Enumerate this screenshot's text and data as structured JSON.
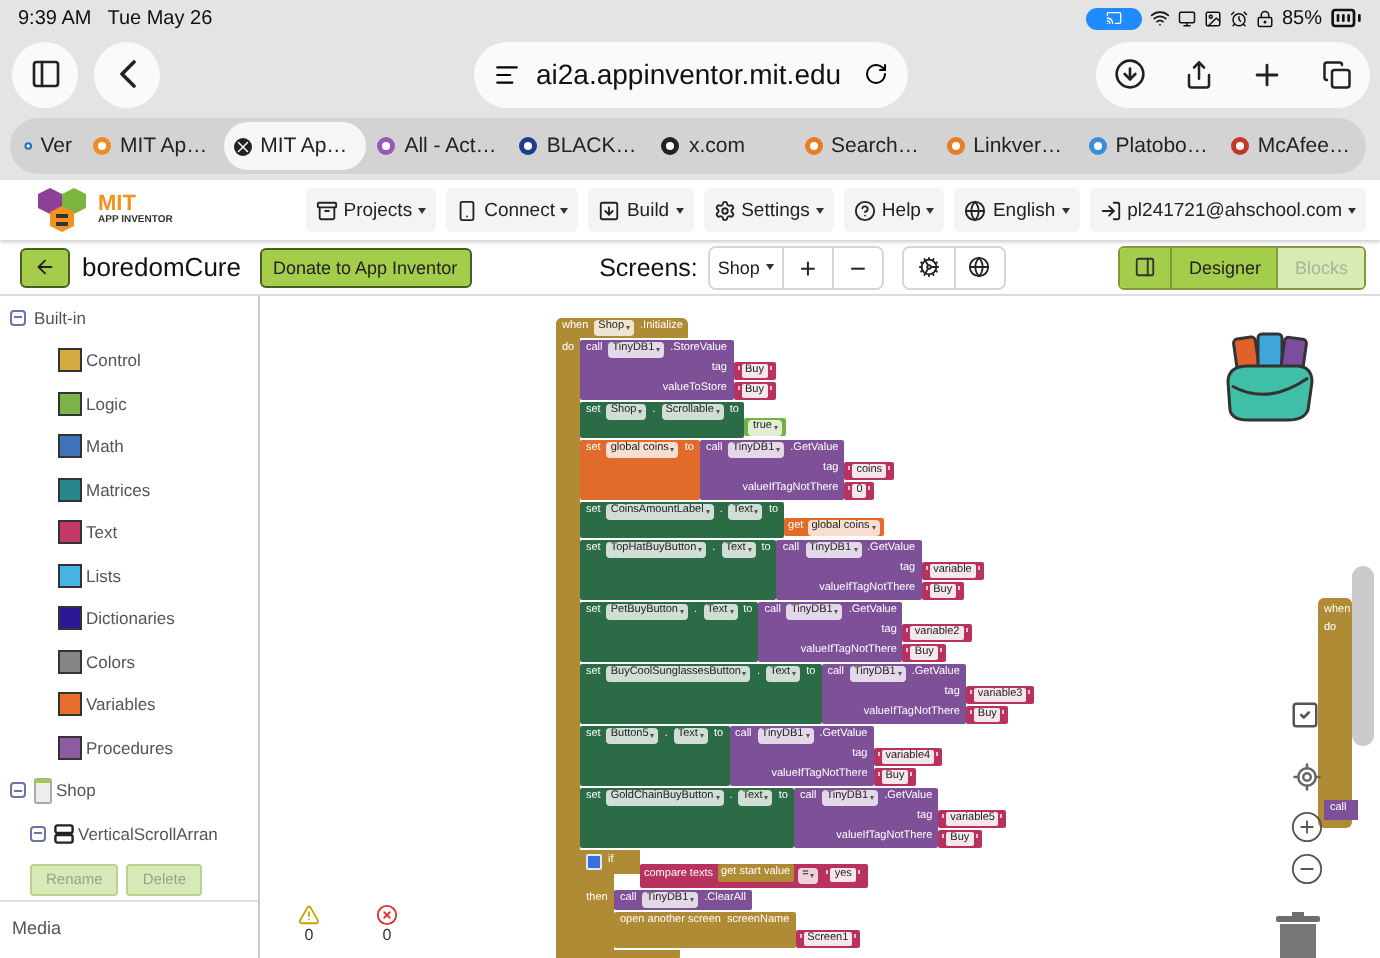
{
  "status_bar": {
    "time": "9:39 AM",
    "date": "Tue May 26",
    "battery": "85%"
  },
  "browser": {
    "url": "ai2a.appinventor.mit.edu",
    "tabs": [
      {
        "label": "Ver",
        "selected": false
      },
      {
        "label": "MIT Ap…",
        "selected": false
      },
      {
        "label": "MIT Ap…",
        "selected": true
      },
      {
        "label": "All - Act…",
        "selected": false
      },
      {
        "label": "BLACK…",
        "selected": false
      },
      {
        "label": "x.com",
        "selected": false
      },
      {
        "label": "Search…",
        "selected": false
      },
      {
        "label": "Linkver…",
        "selected": false
      },
      {
        "label": "Platobo…",
        "selected": false
      },
      {
        "label": "McAfee…",
        "selected": false
      }
    ]
  },
  "app_header": {
    "logo": {
      "title": "MIT",
      "subtitle": "APP INVENTOR"
    },
    "menu": [
      {
        "label": "Projects"
      },
      {
        "label": "Connect"
      },
      {
        "label": "Build"
      },
      {
        "label": "Settings"
      },
      {
        "label": "Help"
      },
      {
        "label": "English"
      },
      {
        "label": "pl241721@ahschool.com"
      }
    ]
  },
  "toolbar": {
    "project_name": "boredomCure",
    "donate": "Donate to App Inventor",
    "screens_label": "Screens:",
    "screen": "Shop",
    "add": "+",
    "remove": "−",
    "views": [
      {
        "label": "Designer",
        "disabled": false
      },
      {
        "label": "Blocks",
        "disabled": true
      }
    ]
  },
  "sidebar": {
    "tree": [
      {
        "kind": "group",
        "label": "Built-in",
        "expanded": true,
        "children": [
          {
            "kind": "category",
            "label": "Control",
            "color": "#d4a93f"
          },
          {
            "kind": "category",
            "label": "Logic",
            "color": "#7cb447"
          },
          {
            "kind": "category",
            "label": "Math",
            "color": "#3f72b8"
          },
          {
            "kind": "category",
            "label": "Matrices",
            "color": "#25878d"
          },
          {
            "kind": "category",
            "label": "Text",
            "color": "#c7386a"
          },
          {
            "kind": "category",
            "label": "Lists",
            "color": "#46b3e6"
          },
          {
            "kind": "category",
            "label": "Dictionaries",
            "color": "#2c1596"
          },
          {
            "kind": "category",
            "label": "Colors",
            "color": "#858585"
          },
          {
            "kind": "category",
            "label": "Variables",
            "color": "#e6702e"
          },
          {
            "kind": "category",
            "label": "Procedures",
            "color": "#8b5ca2"
          }
        ]
      },
      {
        "kind": "screen",
        "label": "Shop",
        "expanded": true,
        "children": [
          {
            "kind": "arrangement",
            "label": "VerticalScrollArran",
            "expanded": true
          }
        ]
      }
    ],
    "buttons": [
      {
        "label": "Rename",
        "disabled": true
      },
      {
        "label": "Delete",
        "disabled": true
      }
    ],
    "media": "Media"
  },
  "workspace": {
    "event": {
      "label": "when",
      "component": "Shop",
      "event": ".Initialize",
      "do_label": "do",
      "statements": [
        {
          "kind": "call",
          "label": "call",
          "component": "TinyDB1",
          "method": ".StoreValue",
          "args": [
            {
              "name": "tag",
              "value": {
                "kind": "text",
                "text": "Buy"
              }
            },
            {
              "name": "valueToStore",
              "value": {
                "kind": "text",
                "text": "Buy"
              }
            }
          ]
        },
        {
          "kind": "set_property",
          "label": "set",
          "component": "Shop",
          "dot": ".",
          "property": "Scrollable",
          "to": "to",
          "value": {
            "kind": "bool",
            "text": "true"
          }
        },
        {
          "kind": "set_global",
          "label": "set",
          "name": "global coins",
          "to": "to",
          "value": {
            "kind": "call",
            "label": "call",
            "component": "TinyDB1",
            "method": ".GetValue",
            "args": [
              {
                "name": "tag",
                "value": {
                  "kind": "text",
                  "text": "coins"
                }
              },
              {
                "name": "valueIfTagNotThere",
                "value": {
                  "kind": "text",
                  "text": "0"
                }
              }
            ]
          }
        },
        {
          "kind": "set_property",
          "label": "set",
          "component": "CoinsAmountLabel",
          "dot": ".",
          "property": "Text",
          "to": "to",
          "value": {
            "kind": "get",
            "label": "get",
            "name": "global coins"
          }
        },
        {
          "kind": "set_property",
          "label": "set",
          "component": "TopHatBuyButton",
          "dot": ".",
          "property": "Text",
          "to": "to",
          "value": {
            "kind": "call",
            "label": "call",
            "component": "TinyDB1",
            "method": ".GetValue",
            "args": [
              {
                "name": "tag",
                "value": {
                  "kind": "text",
                  "text": "variable"
                }
              },
              {
                "name": "valueIfTagNotThere",
                "value": {
                  "kind": "text",
                  "text": "Buy"
                }
              }
            ]
          }
        },
        {
          "kind": "set_property",
          "label": "set",
          "component": "PetBuyButton",
          "dot": ".",
          "property": "Text",
          "to": "to",
          "value": {
            "kind": "call",
            "label": "call",
            "component": "TinyDB1",
            "method": ".GetValue",
            "args": [
              {
                "name": "tag",
                "value": {
                  "kind": "text",
                  "text": "variable2"
                }
              },
              {
                "name": "valueIfTagNotThere",
                "value": {
                  "kind": "text",
                  "text": "Buy"
                }
              }
            ]
          }
        },
        {
          "kind": "set_property",
          "label": "set",
          "component": "BuyCoolSunglassesButton",
          "dot": ".",
          "property": "Text",
          "to": "to",
          "value": {
            "kind": "call",
            "label": "call",
            "component": "TinyDB1",
            "method": ".GetValue",
            "args": [
              {
                "name": "tag",
                "value": {
                  "kind": "text",
                  "text": "variable3"
                }
              },
              {
                "name": "valueIfTagNotThere",
                "value": {
                  "kind": "text",
                  "text": "Buy"
                }
              }
            ]
          }
        },
        {
          "kind": "set_property",
          "label": "set",
          "component": "Button5",
          "dot": ".",
          "property": "Text",
          "to": "to",
          "value": {
            "kind": "call",
            "label": "call",
            "component": "TinyDB1",
            "method": ".GetValue",
            "args": [
              {
                "name": "tag",
                "value": {
                  "kind": "text",
                  "text": "variable4"
                }
              },
              {
                "name": "valueIfTagNotThere",
                "value": {
                  "kind": "text",
                  "text": "Buy"
                }
              }
            ]
          }
        },
        {
          "kind": "set_property",
          "label": "set",
          "component": "GoldChainBuyButton",
          "dot": ".",
          "property": "Text",
          "to": "to",
          "value": {
            "kind": "call",
            "label": "call",
            "component": "TinyDB1",
            "method": ".GetValue",
            "args": [
              {
                "name": "tag",
                "value": {
                  "kind": "text",
                  "text": "variable5"
                }
              },
              {
                "name": "valueIfTagNotThere",
                "value": {
                  "kind": "text",
                  "text": "Buy"
                }
              }
            ]
          }
        },
        {
          "kind": "if",
          "label": "if",
          "condition": {
            "kind": "compare",
            "label": "compare texts",
            "left": {
              "kind": "control",
              "label": "get start value"
            },
            "operator": "=",
            "right": {
              "kind": "text",
              "text": "yes"
            }
          },
          "then_label": "then",
          "then": [
            {
              "kind": "call",
              "label": "call",
              "component": "TinyDB1",
              "method": ".ClearAll"
            },
            {
              "kind": "open_screen",
              "label": "open another screen",
              "arg": "screenName",
              "value": {
                "kind": "text",
                "text": "Screen1"
              }
            }
          ]
        }
      ]
    },
    "partial_block": {
      "label": "when",
      "do_label": "do",
      "call_label": "call"
    },
    "warnings": "0",
    "errors": "0"
  }
}
